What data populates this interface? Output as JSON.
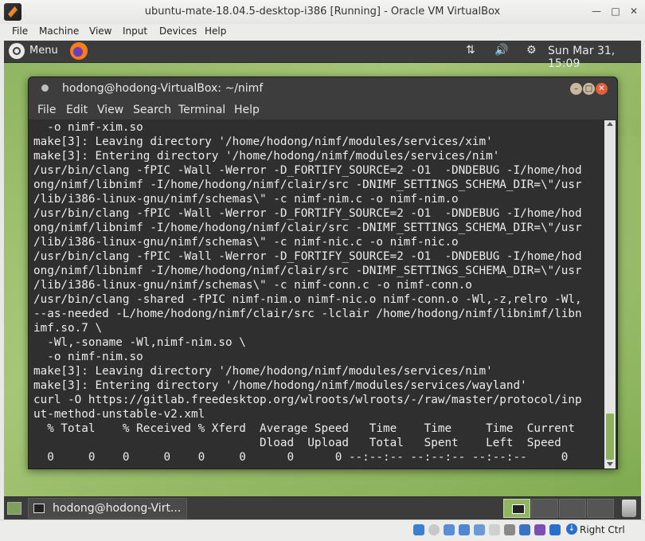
{
  "vbox": {
    "title": "ubuntu-mate-18.04.5-desktop-i386 [Running] - Oracle VM VirtualBox",
    "menus": [
      "File",
      "Machine",
      "View",
      "Input",
      "Devices",
      "Help"
    ],
    "host_key_label": "Right Ctrl"
  },
  "top_panel": {
    "menu_label": "Menu",
    "clock": "Sun Mar 31, 15:09"
  },
  "terminal": {
    "title": "hodong@hodong-VirtualBox: ~/nimf",
    "menus": [
      "File",
      "Edit",
      "View",
      "Search",
      "Terminal",
      "Help"
    ],
    "lines": [
      "  -o nimf-xim.so",
      "make[3]: Leaving directory '/home/hodong/nimf/modules/services/xim'",
      "make[3]: Entering directory '/home/hodong/nimf/modules/services/nim'",
      "/usr/bin/clang -fPIC -Wall -Werror -D_FORTIFY_SOURCE=2 -O1  -DNDEBUG -I/home/hod",
      "ong/nimf/libnimf -I/home/hodong/nimf/clair/src -DNIMF_SETTINGS_SCHEMA_DIR=\\\"/usr",
      "/lib/i386-linux-gnu/nimf/schemas\\\" -c nimf-nim.c -o nimf-nim.o",
      "/usr/bin/clang -fPIC -Wall -Werror -D_FORTIFY_SOURCE=2 -O1  -DNDEBUG -I/home/hod",
      "ong/nimf/libnimf -I/home/hodong/nimf/clair/src -DNIMF_SETTINGS_SCHEMA_DIR=\\\"/usr",
      "/lib/i386-linux-gnu/nimf/schemas\\\" -c nimf-nic.c -o nimf-nic.o",
      "/usr/bin/clang -fPIC -Wall -Werror -D_FORTIFY_SOURCE=2 -O1  -DNDEBUG -I/home/hod",
      "ong/nimf/libnimf -I/home/hodong/nimf/clair/src -DNIMF_SETTINGS_SCHEMA_DIR=\\\"/usr",
      "/lib/i386-linux-gnu/nimf/schemas\\\" -c nimf-conn.c -o nimf-conn.o",
      "/usr/bin/clang -shared -fPIC nimf-nim.o nimf-nic.o nimf-conn.o -Wl,-z,relro -Wl,",
      "--as-needed -L/home/hodong/nimf/clair/src -lclair /home/hodong/nimf/libnimf/libn",
      "imf.so.7 \\",
      "  -Wl,-soname -Wl,nimf-nim.so \\",
      "  -o nimf-nim.so",
      "make[3]: Leaving directory '/home/hodong/nimf/modules/services/nim'",
      "make[3]: Entering directory '/home/hodong/nimf/modules/services/wayland'",
      "curl -O https://gitlab.freedesktop.org/wlroots/wlroots/-/raw/master/protocol/inp",
      "ut-method-unstable-v2.xml",
      "  % Total    % Received % Xferd  Average Speed   Time    Time     Time  Current",
      "                                 Dload  Upload   Total   Spent    Left  Speed",
      "  0     0    0     0    0     0      0      0 --:--:-- --:--:-- --:--:--     0"
    ]
  },
  "taskbar": {
    "task_label": "hodong@hodong-Virt..."
  }
}
